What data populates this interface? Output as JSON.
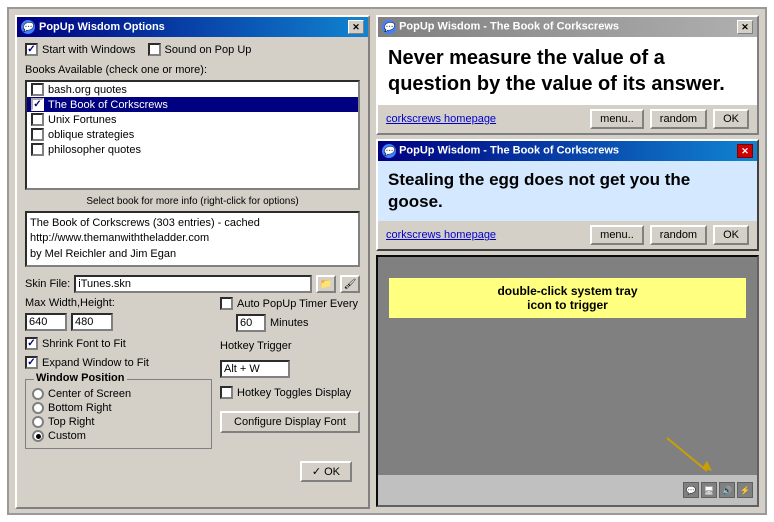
{
  "options_dialog": {
    "title": "PopUp Wisdom Options",
    "close_label": "✕",
    "start_with_windows": "Start with Windows",
    "sound_on_popup": "Sound on Pop Up",
    "books_label": "Books Available (check one or more):",
    "books": [
      {
        "name": "bash.org quotes",
        "checked": false,
        "selected": false
      },
      {
        "name": "The Book of Corkscrews",
        "checked": true,
        "selected": true
      },
      {
        "name": "Unix Fortunes",
        "checked": false,
        "selected": false
      },
      {
        "name": "oblique strategies",
        "checked": false,
        "selected": false
      },
      {
        "name": "philosopher quotes",
        "checked": false,
        "selected": false
      }
    ],
    "book_info_hint": "Select book for more info (right-click for options)",
    "book_info_text": "The Book of Corkscrews (303 entries) - cached\nhttp://www.themanwiththeladder.com\nby Mel Reichler and Jim Egan",
    "skin_label": "Skin File:",
    "skin_value": "iTunes.skn",
    "max_size_label": "Max Width,Height:",
    "max_width": "640",
    "max_height": "480",
    "shrink_font": "Shrink Font to Fit",
    "expand_window": "Expand Window to Fit",
    "window_position_label": "Window Position",
    "positions": [
      {
        "label": "Center of Screen",
        "selected": false
      },
      {
        "label": "Bottom Right",
        "selected": false
      },
      {
        "label": "Top Right",
        "selected": false
      },
      {
        "label": "Custom",
        "selected": true
      }
    ],
    "auto_popup_label": "Auto PopUp Timer Every",
    "auto_popup_minutes": "60",
    "minutes_label": "Minutes",
    "hotkey_trigger_label": "Hotkey Trigger",
    "hotkey_value": "Alt + W",
    "hotkey_toggles_label": "Hotkey Toggles Display",
    "configure_display_font": "Configure Display Font",
    "ok_label": "✓ OK"
  },
  "wisdom_gray": {
    "title": "PopUp Wisdom - The Book of Corkscrews",
    "quote": "Never measure the value of a question by the value of its answer.",
    "homepage_link": "corkscrews homepage",
    "menu_btn": "menu..",
    "random_btn": "random",
    "ok_btn": "OK"
  },
  "wisdom_blue": {
    "title": "PopUp Wisdom - The Book of Corkscrews",
    "quote": "Stealing the egg does not get you the goose.",
    "homepage_link": "corkscrews homepage",
    "menu_btn": "menu..",
    "random_btn": "random",
    "ok_btn": "OK",
    "close_label": "✕"
  },
  "tray_demo": {
    "tooltip": "double-click system tray\nicon to trigger",
    "tooltip_line1": "double-click system tray",
    "tooltip_line2": "icon to trigger"
  },
  "icons": {
    "title_bubble": "💬",
    "folder": "📁",
    "brush": "🖌",
    "checkmark": "✓",
    "close": "✕"
  }
}
